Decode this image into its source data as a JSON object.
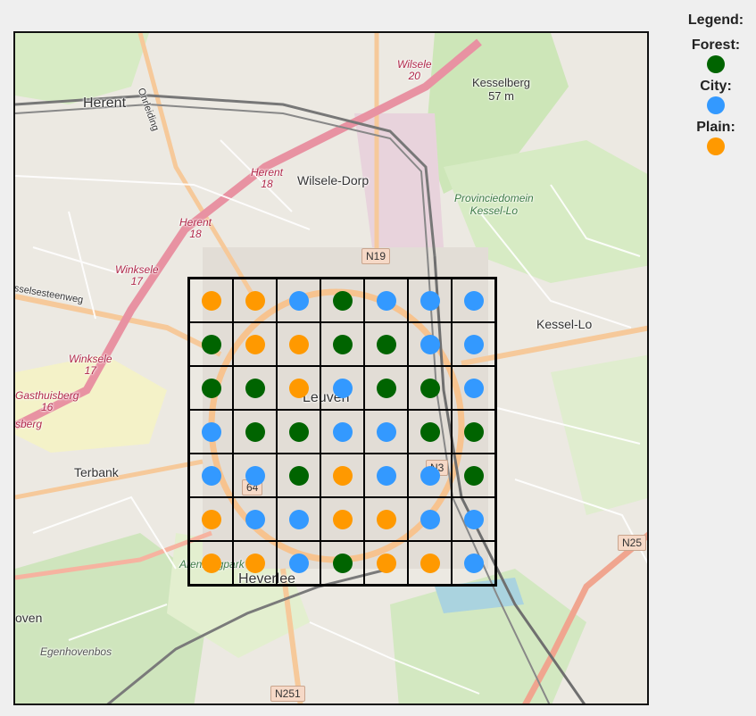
{
  "legend": {
    "title": "Legend:",
    "items": [
      {
        "label": "Forest:",
        "key": "forest"
      },
      {
        "label": "City:",
        "key": "city"
      },
      {
        "label": "Plain:",
        "key": "plain"
      }
    ]
  },
  "colors": {
    "forest": "#006400",
    "city": "#3399ff",
    "plain": "#ff9900"
  },
  "grid": {
    "cells": [
      [
        "plain",
        "plain",
        "city",
        "forest",
        "city",
        "city",
        "city"
      ],
      [
        "forest",
        "plain",
        "plain",
        "forest",
        "forest",
        "city",
        "city"
      ],
      [
        "forest",
        "forest",
        "plain",
        "city",
        "forest",
        "forest",
        "city"
      ],
      [
        "city",
        "forest",
        "forest",
        "city",
        "city",
        "forest",
        "forest"
      ],
      [
        "city",
        "city",
        "forest",
        "plain",
        "city",
        "city",
        "forest"
      ],
      [
        "plain",
        "city",
        "city",
        "plain",
        "plain",
        "city",
        "city"
      ],
      [
        "plain",
        "plain",
        "city",
        "forest",
        "plain",
        "plain",
        "city"
      ]
    ]
  },
  "map": {
    "places": {
      "herent": "Herent",
      "wilsele_dorp": "Wilsele-Dorp",
      "kessel_lo": "Kessel-Lo",
      "leuven": "Leuven",
      "terbank": "Terbank",
      "heverlee": "Heverlee",
      "oven": "oven",
      "kesselberg": "Kesselberg",
      "kesselberg_elev": "57 m",
      "egenhovenbos": "Egenhovenbos",
      "arenbergpark": "Arenbergpark",
      "provinciedomein_1": "Provinciedomein",
      "provinciedomein_2": "Kessel-Lo",
      "gasthuisberg_end": "sberg",
      "rue_partial": "sselsesteenweg",
      "onderdiging": "Onrleiding"
    },
    "stations": {
      "wilsele": {
        "name": "Wilsele",
        "num": "20"
      },
      "herent_18a": {
        "name": "Herent",
        "num": "18"
      },
      "herent_18b": {
        "name": "Herent",
        "num": "18"
      },
      "winksele_1": {
        "name": "Winksele",
        "num": "17"
      },
      "winksele_2": {
        "name": "Winksele",
        "num": "17"
      },
      "gasthuisberg": {
        "name": "Gasthuisberg",
        "num": "16"
      }
    },
    "roads": {
      "n19": "N19",
      "n3": "N3",
      "n25": "N25",
      "n251": "N251",
      "r64": "64"
    }
  }
}
